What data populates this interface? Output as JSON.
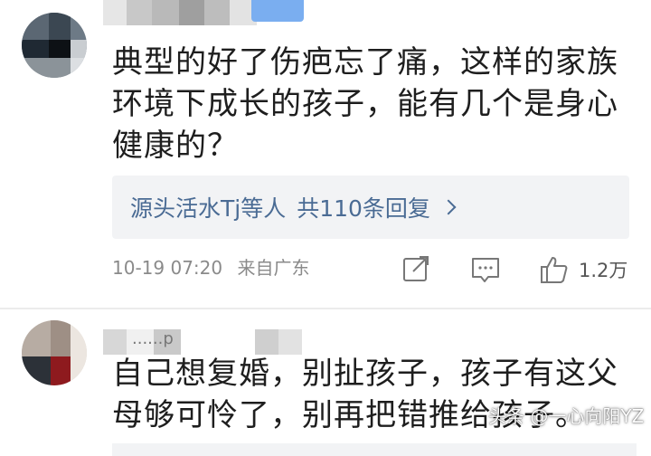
{
  "comments": [
    {
      "text": "典型的好了伤疤忘了痛，这样的家族环境下成长的孩子，能有几个是身心健康的？",
      "replies": {
        "names": "源头活水Tj等人",
        "count_label": "共110条回复"
      },
      "timestamp": "10-19 07:20",
      "location": "来自广东",
      "likes": "1.2万",
      "icons": [
        "share-icon",
        "comment-icon",
        "thumbs-up-icon"
      ]
    },
    {
      "text": "自己想复婚，别扯孩子，孩子有这父母够可怜了，别再把错推给孩子。",
      "username_partial": "......p"
    }
  ],
  "watermark": "头条 @一心向阳YZ",
  "colors": {
    "reply_link": "#4a6b94",
    "reply_bg": "#f2f3f5",
    "meta_text": "#8a8a8a",
    "badge": "#7aaef0"
  }
}
